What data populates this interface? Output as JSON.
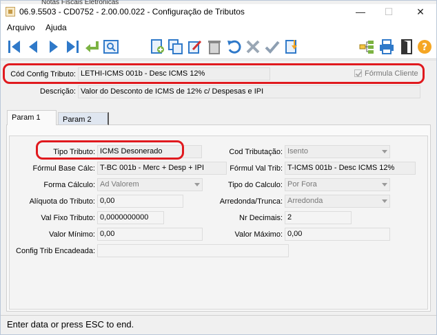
{
  "background_window_text": "Notas Fiscais Eletronicas",
  "window": {
    "title": "06.9.5503 - CD0752 - 2.00.00.022 - Configuração de Tributos",
    "minimize": "—",
    "maximize": "☐",
    "close": "✕"
  },
  "menu": {
    "items": [
      "Arquivo",
      "Ajuda"
    ]
  },
  "toolbar": {
    "icons": [
      "first-icon",
      "previous-icon",
      "next-icon",
      "last-icon",
      "return-icon",
      "search-icon",
      "new-icon",
      "copy-icon",
      "edit-icon",
      "delete-icon",
      "undo-icon",
      "cancel-icon",
      "confirm-icon",
      "import-icon",
      "tree-icon",
      "print-icon",
      "exit-icon",
      "help-icon"
    ]
  },
  "header": {
    "cod_config_label": "Cód Config Tributo:",
    "cod_config_value": "LETHI-ICMS 001b - Desc ICMS 12%",
    "formula_cliente_label": "Fórmula Cliente",
    "formula_cliente_checked": true,
    "descricao_label": "Descrição:",
    "descricao_value": "Valor do Desconto de ICMS de 12% c/ Despesas e IPI"
  },
  "tabs": [
    "Param 1",
    "Param 2"
  ],
  "form": {
    "tipo_tributo_label": "Tipo Tributo:",
    "tipo_tributo_value": "ICMS Desonerado",
    "cod_tributacao_label": "Cod Tributação:",
    "cod_tributacao_value": "Isento",
    "formul_base_label": "Fórmul Base Cálc:",
    "formul_base_value": "T-BC 001b - Merc + Desp + IPI",
    "formul_val_trib_label": "Fórmul Val Trib:",
    "formul_val_trib_value": "T-ICMS 001b - Desc ICMS 12%",
    "forma_calculo_label": "Forma Cálculo:",
    "forma_calculo_value": "Ad Valorem",
    "tipo_calculo_label": "Tipo do Calculo:",
    "tipo_calculo_value": "Por Fora",
    "aliquota_label": "Alíquota do Tributo:",
    "aliquota_value": "0,00",
    "arredonda_label": "Arredonda/Trunca:",
    "arredonda_value": "Arredonda",
    "val_fixo_label": "Val Fixo Tributo:",
    "val_fixo_value": "0,0000000000",
    "nr_decimais_label": "Nr Decimais:",
    "nr_decimais_value": "2",
    "valor_minimo_label": "Valor Mínimo:",
    "valor_minimo_value": "0,00",
    "valor_maximo_label": "Valor Máximo:",
    "valor_maximo_value": "0,00",
    "config_trib_label": "Config Trib Encadeada:",
    "config_trib_value": ""
  },
  "status": {
    "text": "Enter data or press ESC to end."
  },
  "colors": {
    "highlight_red": "#e0191e",
    "toolbar_blue": "#2f79c9",
    "field_bg": "#eeeeee"
  }
}
